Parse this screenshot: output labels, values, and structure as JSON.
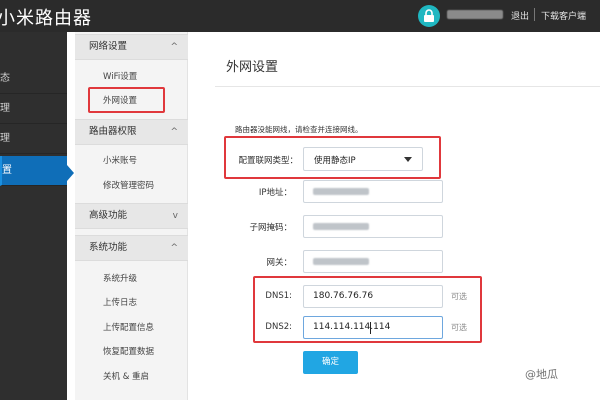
{
  "app": {
    "brand": "小米路由器"
  },
  "topbar": {
    "username": "",
    "logout_label": "退出",
    "download_label": "下载客户端"
  },
  "left_nav": {
    "items": [
      {
        "label": "态"
      },
      {
        "label": "理"
      },
      {
        "label": "理"
      },
      {
        "label": "置"
      }
    ]
  },
  "sub_nav": {
    "sections": [
      {
        "title": "网络设置",
        "chevron": "^",
        "items": [
          "WiFi设置",
          "外网设置"
        ]
      },
      {
        "title": "路由器权限",
        "chevron": "^",
        "items": [
          "小米账号",
          "修改管理密码"
        ]
      },
      {
        "title": "高级功能",
        "chevron": "v",
        "items": []
      },
      {
        "title": "系统功能",
        "chevron": "^",
        "items": [
          "系统升级",
          "上传日志",
          "上传配置信息",
          "恢复配置数据",
          "关机 & 重启"
        ]
      }
    ]
  },
  "main": {
    "title": "外网设置",
    "hint": "路由器没能网线，请检查并连接网线。",
    "conn_type_label": "配置联网类型：",
    "conn_type_value": "使用静态IP",
    "ip_label": "IP地址：",
    "mask_label": "子网掩码：",
    "gateway_label": "网关：",
    "dns1_label": "DNS1:",
    "dns1_value": "180.76.76.76",
    "dns2_label": "DNS2:",
    "dns2_value": "114.114.114.114",
    "optional_label": "可选",
    "ok_button": "确定"
  },
  "watermark": "@地瓜",
  "colors": {
    "topbar": "#2b2b2b",
    "active_nav": "#0f6eb8",
    "highlight": "#e0383c",
    "button": "#21a6e3",
    "lock": "#1fb7c1"
  },
  "icons": [
    "lock-icon",
    "chevron-up-icon",
    "chevron-down-icon",
    "caret-down-icon"
  ]
}
